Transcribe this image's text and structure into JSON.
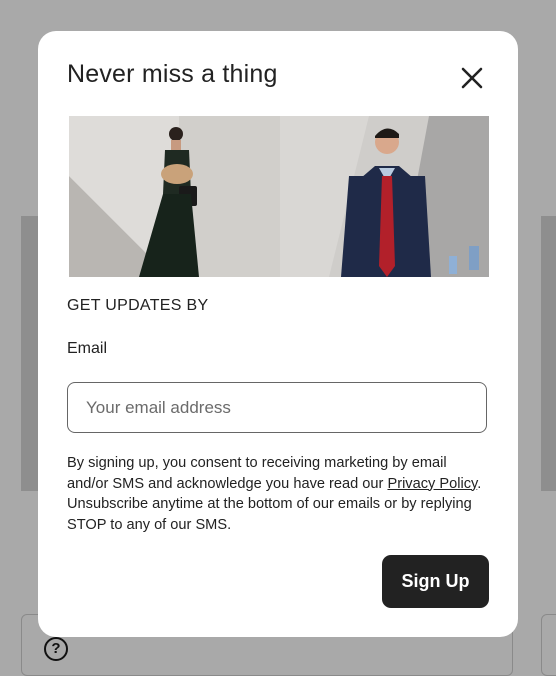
{
  "modal": {
    "title": "Never miss a thing",
    "close_icon": "close-icon",
    "section_label": "GET UPDATES BY",
    "email_label": "Email",
    "email_placeholder": "Your email address",
    "email_value": "",
    "consent": {
      "part1": "By signing up, you consent to receiving marketing by email and/or SMS and acknowledge you have read our ",
      "link_text": "Privacy Policy",
      "part2": ". Unsubscribe anytime at the bottom of our emails or by replying STOP to any of our SMS."
    },
    "submit_label": "Sign Up"
  },
  "background": {
    "help_icon": "question-circle-icon",
    "help_glyph": "?"
  },
  "colors": {
    "overlay": "#a9a9a9",
    "button": "#222222",
    "text": "#222222"
  }
}
